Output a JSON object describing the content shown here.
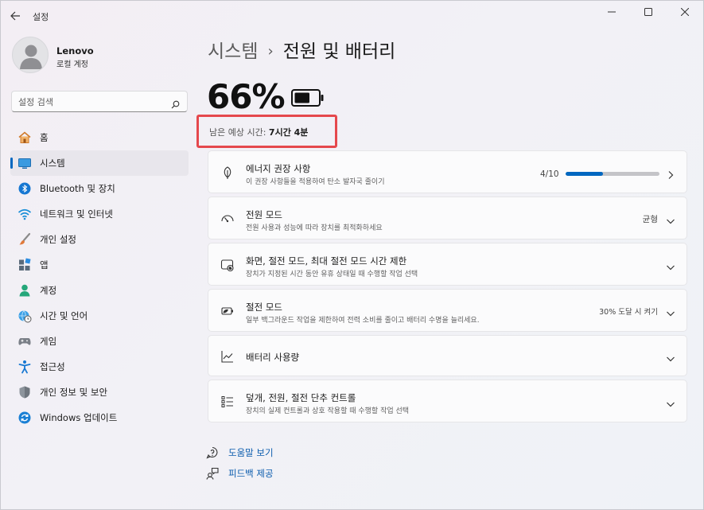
{
  "window": {
    "title": "설정",
    "controls": [
      "minimize",
      "maximize",
      "close"
    ]
  },
  "profile": {
    "name": "Lenovo",
    "account_type": "로컬 계정"
  },
  "search": {
    "placeholder": "설정 검색"
  },
  "sidebar": {
    "active_index": 1,
    "items": [
      {
        "label": "홈",
        "icon": "home-icon"
      },
      {
        "label": "시스템",
        "icon": "system-icon"
      },
      {
        "label": "Bluetooth 및 장치",
        "icon": "bluetooth-icon"
      },
      {
        "label": "네트워크 및 인터넷",
        "icon": "wifi-icon"
      },
      {
        "label": "개인 설정",
        "icon": "paintbrush-icon"
      },
      {
        "label": "앱",
        "icon": "apps-icon"
      },
      {
        "label": "계정",
        "icon": "account-icon"
      },
      {
        "label": "시간 및 언어",
        "icon": "globe-clock-icon"
      },
      {
        "label": "게임",
        "icon": "gamepad-icon"
      },
      {
        "label": "접근성",
        "icon": "accessibility-icon"
      },
      {
        "label": "개인 정보 및 보안",
        "icon": "shield-icon"
      },
      {
        "label": "Windows 업데이트",
        "icon": "update-icon"
      }
    ]
  },
  "header": {
    "parent": "시스템",
    "separator": "›",
    "current": "전원 및 배터리"
  },
  "battery": {
    "percent_label": "66%",
    "level": 0.66,
    "estimate_label": "남은 예상 시간:",
    "estimate_value": "7시간 4분"
  },
  "cards": [
    {
      "title": "에너지 권장 사항",
      "subtitle": "이 권장 사항들을 적용하여 탄소 발자국 줄이기",
      "icon": "leaf-icon",
      "progress_label": "4/10",
      "progress": 0.4,
      "chevron": "right"
    },
    {
      "title": "전원 모드",
      "subtitle": "전원 사용과 성능에 따라 장치를 최적화하세요",
      "icon": "power-mode-icon",
      "value": "균형",
      "chevron": "down"
    },
    {
      "title": "화면, 절전 모드, 최대 절전 모드 시간 제한",
      "subtitle": "장치가 지정된 시간 동안 유휴 상태일 때 수행할 작업 선택",
      "icon": "screen-sleep-icon",
      "chevron": "down"
    },
    {
      "title": "절전 모드",
      "subtitle": "일부 백그라운드 작업을 제한하여 전력 소비를 줄이고 배터리 수명을 늘리세요.",
      "icon": "battery-saver-icon",
      "value": "30% 도달 시 켜기",
      "chevron": "down"
    },
    {
      "title": "배터리 사용량",
      "subtitle": "",
      "icon": "chart-icon",
      "chevron": "down"
    },
    {
      "title": "덮개, 전원, 절전 단추 컨트롤",
      "subtitle": "장치의 실제 컨트롤과 상호 작용할 때 수행할 작업 선택",
      "icon": "controls-list-icon",
      "chevron": "down"
    }
  ],
  "links": [
    {
      "label": "도움말 보기",
      "icon": "help-icon"
    },
    {
      "label": "피드백 제공",
      "icon": "feedback-icon"
    }
  ],
  "colors": {
    "accent": "#0067c0",
    "highlight": "#e5484d"
  }
}
